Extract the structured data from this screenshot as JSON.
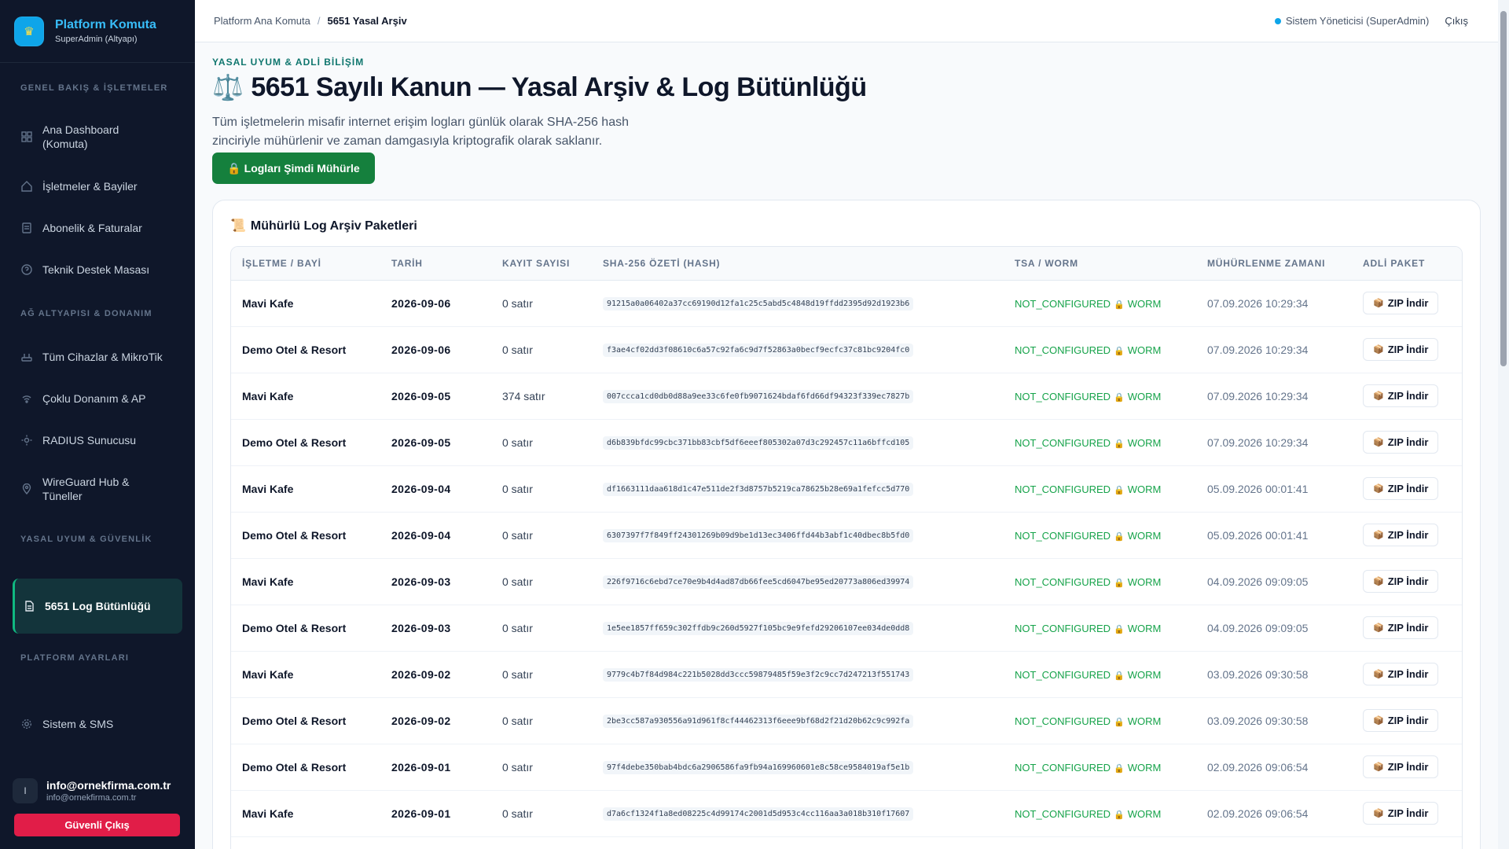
{
  "brand": {
    "title": "Platform Komuta",
    "subtitle": "SuperAdmin (Altyapı)",
    "logo_glyph": "♛"
  },
  "sidebar": {
    "sections": [
      {
        "label": "GENEL BAKIŞ & İŞLETMELER"
      },
      {
        "label": "AĞ ALTYAPISI & DONANIM"
      },
      {
        "label": "YASAL UYUM & GÜVENLİK"
      },
      {
        "label": "PLATFORM AYARLARI"
      }
    ],
    "items": [
      {
        "label": "Ana Dashboard (Komuta)",
        "icon": "grid-icon"
      },
      {
        "label": "İşletmeler & Bayiler",
        "icon": "home-icon"
      },
      {
        "label": "Abonelik & Faturalar",
        "icon": "document-icon"
      },
      {
        "label": "Teknik Destek Masası",
        "icon": "help-icon"
      },
      {
        "label": "Tüm Cihazlar & MikroTik",
        "icon": "router-icon"
      },
      {
        "label": "Çoklu Donanım & AP",
        "icon": "wifi-icon"
      },
      {
        "label": "RADIUS Sunucusu",
        "icon": "sun-icon"
      },
      {
        "label": "WireGuard Hub & Tüneller",
        "icon": "location-icon"
      },
      {
        "label": "5651 Log Bütünlüğü",
        "icon": "file-icon",
        "active": true
      },
      {
        "label": "Sistem & SMS",
        "icon": "gear-icon"
      }
    ]
  },
  "user": {
    "initial": "I",
    "name": "info@ornekfirma.com.tr",
    "email": "info@ornekfirma.com.tr",
    "logout_label": "Güvenli Çıkış"
  },
  "topbar": {
    "breadcrumb_root": "Platform Ana Komuta",
    "breadcrumb_sep": "/",
    "breadcrumb_current": "5651 Yasal Arşiv",
    "user_role": "Sistem Yöneticisi (SuperAdmin)",
    "logout": "Çıkış",
    "status_color": "#0ea5e9"
  },
  "page": {
    "eyebrow": "YASAL UYUM & ADLİ BİLİŞİM",
    "title_icon": "⚖️",
    "title": "5651 Sayılı Kanun — Yasal Arşiv & Log Bütünlüğü",
    "description": "Tüm işletmelerin misafir internet erişim logları günlük olarak SHA-256 hash zinciriyle mühürlenir ve zaman damgasıyla kriptografik olarak saklanır.",
    "seal_button": "🔒 Logları Şimdi Mühürle"
  },
  "archive": {
    "title_icon": "📜",
    "title": "Mühürlü Log Arşiv Paketleri",
    "columns": [
      "İŞLETME / BAYİ",
      "TARİH",
      "KAYIT SAYISI",
      "SHA-256 ÖZETİ (HASH)",
      "TSA / WORM",
      "MÜHÜRLENME ZAMANI",
      "ADLİ PAKET"
    ],
    "tsa_label": "NOT_CONFIGURED",
    "worm_label": "WORM",
    "lock_glyph": "🔒",
    "zip_icon": "📦",
    "zip_label": "ZIP İndir",
    "rows": [
      {
        "business": "Mavi Kafe",
        "date": "2026-09-06",
        "count": "0 satır",
        "hash": "91215a0a06402a37cc69190d12fa1c25c5abd5c4848d19ffdd2395d92d1923b6",
        "sealed_at": "07.09.2026 10:29:34"
      },
      {
        "business": "Demo Otel & Resort",
        "date": "2026-09-06",
        "count": "0 satır",
        "hash": "f3ae4cf02dd3f08610c6a57c92fa6c9d7f52863a0becf9ecfc37c81bc9204fc0",
        "sealed_at": "07.09.2026 10:29:34"
      },
      {
        "business": "Mavi Kafe",
        "date": "2026-09-05",
        "count": "374 satır",
        "hash": "007ccca1cd0db0d88a9ee33c6fe0fb9071624bdaf6fd66df94323f339ec7827b",
        "sealed_at": "07.09.2026 10:29:34"
      },
      {
        "business": "Demo Otel & Resort",
        "date": "2026-09-05",
        "count": "0 satır",
        "hash": "d6b839bfdc99cbc371bb83cbf5df6eeef805302a07d3c292457c11a6bffcd105",
        "sealed_at": "07.09.2026 10:29:34"
      },
      {
        "business": "Mavi Kafe",
        "date": "2026-09-04",
        "count": "0 satır",
        "hash": "df1663111daa618d1c47e511de2f3d8757b5219ca78625b28e69a1fefcc5d770",
        "sealed_at": "05.09.2026 00:01:41"
      },
      {
        "business": "Demo Otel & Resort",
        "date": "2026-09-04",
        "count": "0 satır",
        "hash": "6307397f7f849ff24301269b09d9be1d13ec3406ffd44b3abf1c40dbec8b5fd0",
        "sealed_at": "05.09.2026 00:01:41"
      },
      {
        "business": "Mavi Kafe",
        "date": "2026-09-03",
        "count": "0 satır",
        "hash": "226f9716c6ebd7ce70e9b4d4ad87db66fee5cd6047be95ed20773a806ed39974",
        "sealed_at": "04.09.2026 09:09:05"
      },
      {
        "business": "Demo Otel & Resort",
        "date": "2026-09-03",
        "count": "0 satır",
        "hash": "1e5ee1857ff659c302ffdb9c260d5927f105bc9e9fefd29206107ee034de0dd8",
        "sealed_at": "04.09.2026 09:09:05"
      },
      {
        "business": "Mavi Kafe",
        "date": "2026-09-02",
        "count": "0 satır",
        "hash": "9779c4b7f84d984c221b5028dd3ccc59879485f59e3f2c9cc7d247213f551743",
        "sealed_at": "03.09.2026 09:30:58"
      },
      {
        "business": "Demo Otel & Resort",
        "date": "2026-09-02",
        "count": "0 satır",
        "hash": "2be3cc587a930556a91d961f8cf44462313f6eee9bf68d2f21d20b62c9c992fa",
        "sealed_at": "03.09.2026 09:30:58"
      },
      {
        "business": "Demo Otel & Resort",
        "date": "2026-09-01",
        "count": "0 satır",
        "hash": "97f4debe350bab4bdc6a2906586fa9fb94a169960601e8c58ce9584019af5e1b",
        "sealed_at": "02.09.2026 09:06:54"
      },
      {
        "business": "Mavi Kafe",
        "date": "2026-09-01",
        "count": "0 satır",
        "hash": "d7a6cf1324f1a8ed08225c4d99174c2001d5d953c4cc116aa3a018b310f17607",
        "sealed_at": "02.09.2026 09:06:54"
      }
    ]
  },
  "colors": {
    "sidebar_bg": "#0f172a",
    "accent_green": "#15803d",
    "accent_blue": "#38bdf8",
    "logout_red": "#e11d48",
    "status_green": "#16a34a"
  }
}
